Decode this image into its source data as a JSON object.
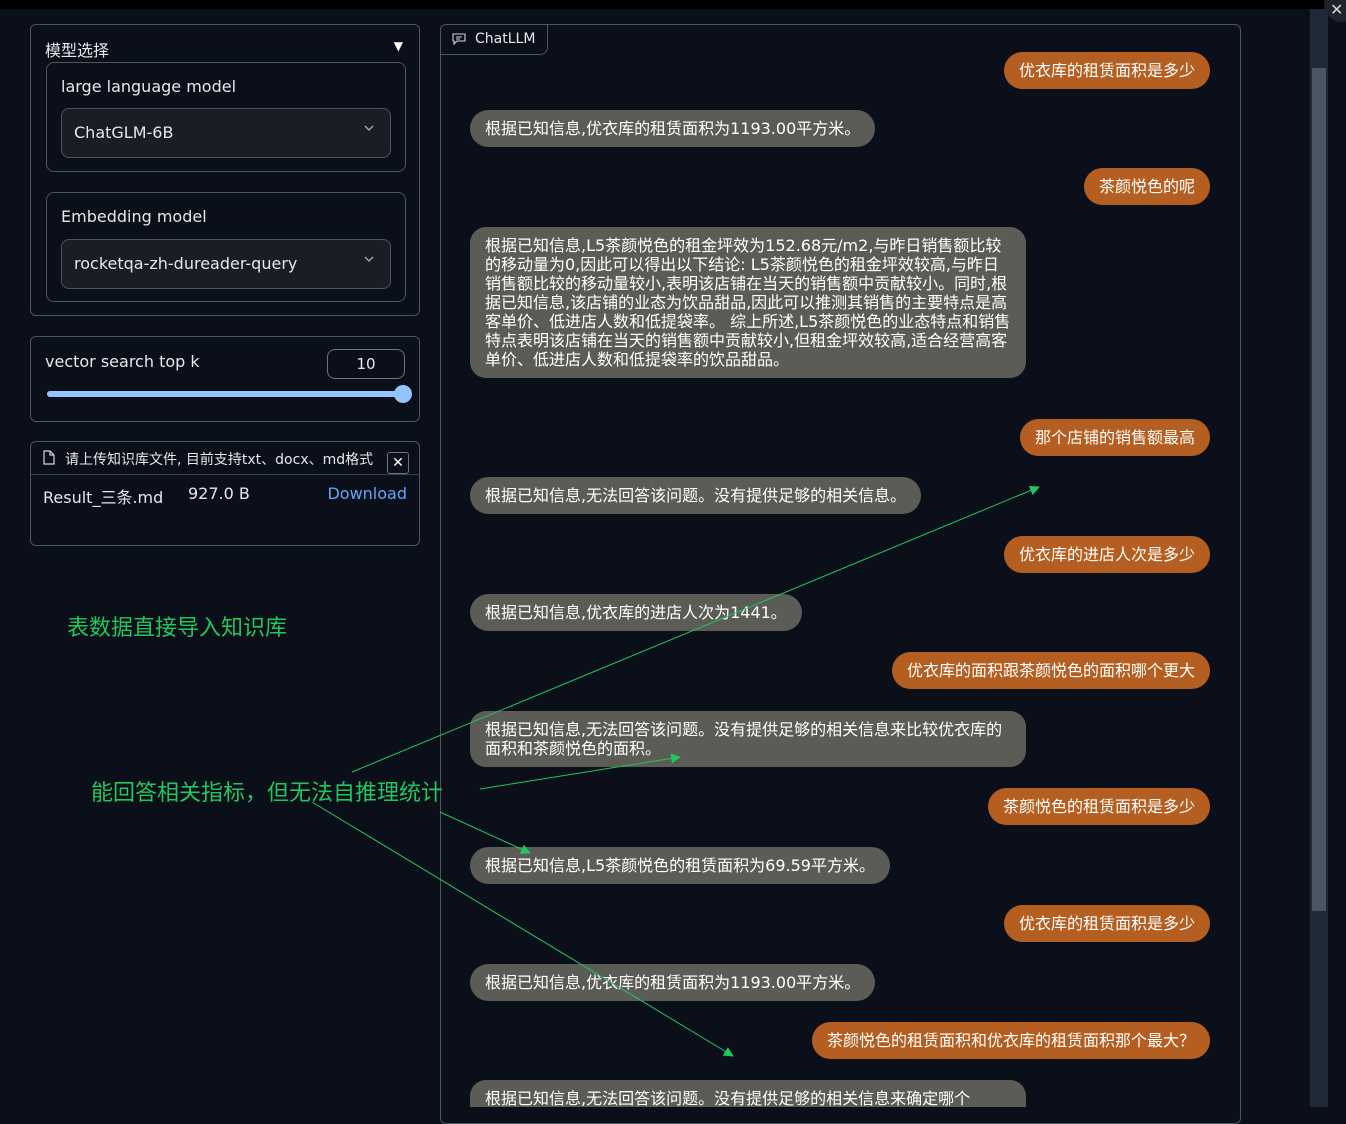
{
  "window": {
    "close_glyph": "✕"
  },
  "model_panel": {
    "title": "模型选择",
    "llm": {
      "label": "large language model",
      "value": "ChatGLM-6B"
    },
    "embedding": {
      "label": "Embedding model",
      "value": "rocketqa-zh-dureader-query"
    }
  },
  "topk": {
    "label": "vector search top k",
    "value": "10",
    "fraction": 1.0
  },
  "upload": {
    "header": "请上传知识库文件, 目前支持txt、docx、md格式",
    "close_glyph": "✕",
    "file_name": "Result_三条.md",
    "file_size": "927.0 B",
    "download_label": "Download"
  },
  "chat": {
    "tab_label": "ChatLLM",
    "messages": [
      {
        "role": "user",
        "text": "优衣库的租赁面积是多少"
      },
      {
        "role": "bot",
        "text": "根据已知信息,优衣库的租赁面积为1193.00平方米。"
      },
      {
        "role": "user",
        "text": "茶颜悦色的呢"
      },
      {
        "role": "bot",
        "text": "根据已知信息,L5茶颜悦色的租金坪效为152.68元/m2,与昨日销售额比较的移动量为0,因此可以得出以下结论: L5茶颜悦色的租金坪效较高,与昨日销售额比较的移动量较小,表明该店铺在当天的销售额中贡献较小。同时,根据已知信息,该店铺的业态为饮品甜品,因此可以推测其销售的主要特点是高客单价、低进店人数和低提袋率。 综上所述,L5茶颜悦色的业态特点和销售特点表明该店铺在当天的销售额中贡献较小,但租金坪效较高,适合经营高客单价、低进店人数和低提袋率的饮品甜品。"
      },
      {
        "role": "user",
        "text": "那个店铺的销售额最高"
      },
      {
        "role": "bot",
        "text": "根据已知信息,无法回答该问题。没有提供足够的相关信息。"
      },
      {
        "role": "user",
        "text": "优衣库的进店人次是多少"
      },
      {
        "role": "bot",
        "text": "根据已知信息,优衣库的进店人次为1441。"
      },
      {
        "role": "user",
        "text": "优衣库的面积跟茶颜悦色的面积哪个更大"
      },
      {
        "role": "bot",
        "text": "根据已知信息,无法回答该问题。没有提供足够的相关信息来比较优衣库的面积和茶颜悦色的面积。"
      },
      {
        "role": "user",
        "text": "茶颜悦色的租赁面积是多少"
      },
      {
        "role": "bot",
        "text": "根据已知信息,L5茶颜悦色的租赁面积为69.59平方米。"
      },
      {
        "role": "user",
        "text": "优衣库的租赁面积是多少"
      },
      {
        "role": "bot",
        "text": "根据已知信息,优衣库的租赁面积为1193.00平方米。"
      },
      {
        "role": "user",
        "text": "茶颜悦色的租赁面积和优衣库的租赁面积那个最大？"
      },
      {
        "role": "bot",
        "text": "根据已知信息,无法回答该问题。没有提供足够的相关信息来确定哪个"
      }
    ]
  },
  "annotations": {
    "note1": "表数据直接导入知识库",
    "note2": "能回答相关指标，但无法自推理统计"
  },
  "colors": {
    "background": "#0b0f19",
    "user_bubble": "#b45f21",
    "bot_bubble": "#5c5c57",
    "annotation_green": "#22c55e",
    "link_blue": "#60a5fa",
    "slider_blue": "#93c5fd"
  }
}
